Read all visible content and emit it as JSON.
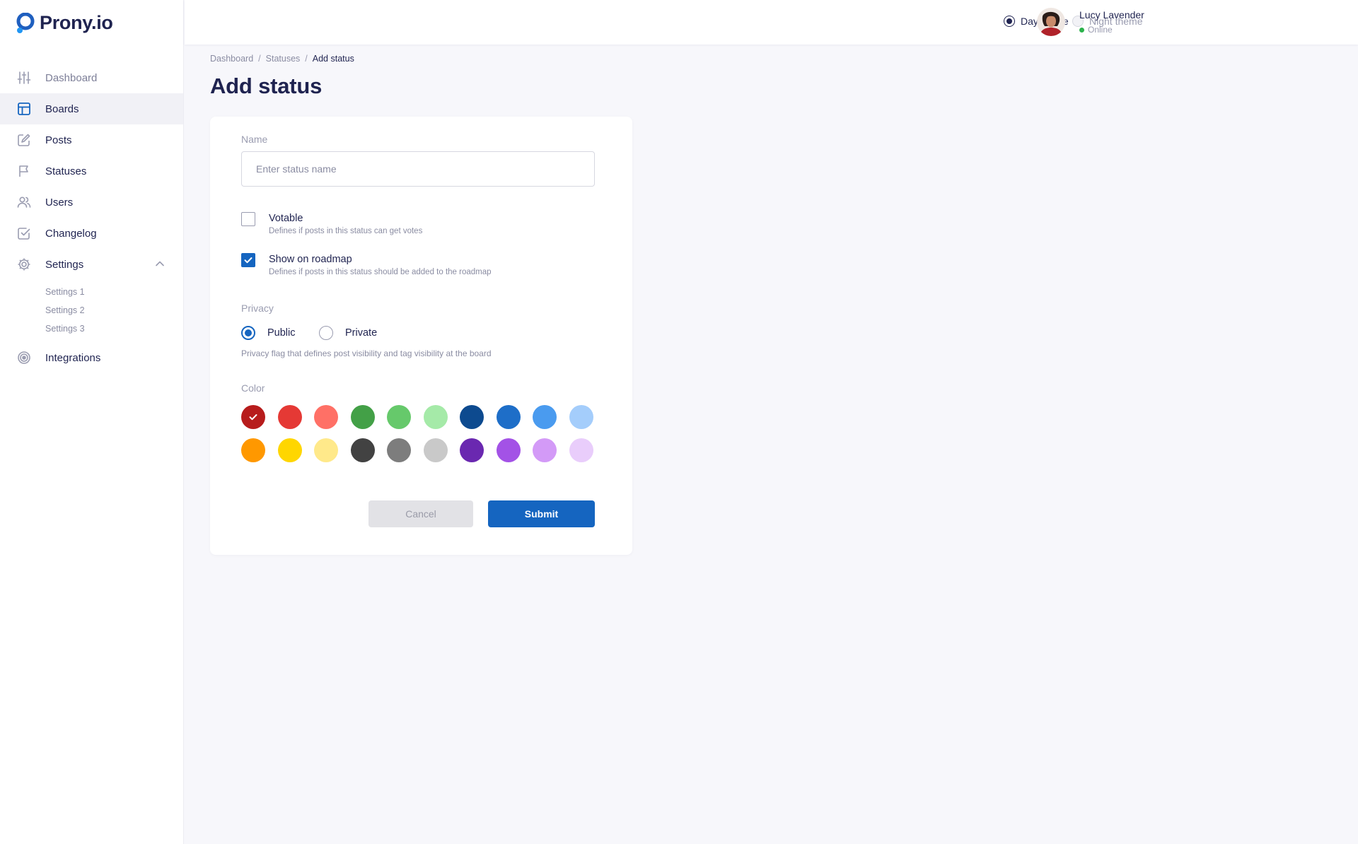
{
  "app": {
    "logo_text": "Prony.io",
    "brand_color": "#1565c0"
  },
  "sidebar": {
    "items": [
      {
        "label": "Dashboard",
        "icon": "sliders-icon"
      },
      {
        "label": "Boards",
        "icon": "layout-icon"
      },
      {
        "label": "Posts",
        "icon": "edit-icon"
      },
      {
        "label": "Statuses",
        "icon": "flag-icon"
      },
      {
        "label": "Users",
        "icon": "users-icon"
      },
      {
        "label": "Changelog",
        "icon": "check-square-icon"
      },
      {
        "label": "Settings",
        "icon": "gear-icon"
      },
      {
        "label": "Integrations",
        "icon": "target-icon"
      }
    ],
    "settings_sub": [
      "Settings 1",
      "Settings 2",
      "Settings 3"
    ],
    "active": "Boards"
  },
  "header": {
    "themes": [
      {
        "label": "Day theme",
        "selected": true
      },
      {
        "label": "Night theme",
        "selected": false
      }
    ],
    "user": {
      "name": "Lucy Lavender",
      "status": "Online"
    }
  },
  "breadcrumb": [
    "Dashboard",
    "Statuses",
    "Add status"
  ],
  "page_title": "Add status",
  "form": {
    "name_label": "Name",
    "name_placeholder": "Enter status name",
    "name_value": "",
    "votable": {
      "title": "Votable",
      "desc": "Defines if posts in this status can get votes",
      "checked": false
    },
    "roadmap": {
      "title": "Show on roadmap",
      "desc": "Defines if posts in this status should be added to the roadmap",
      "checked": true
    },
    "privacy_label": "Privacy",
    "privacy_options": [
      {
        "label": "Public",
        "selected": true
      },
      {
        "label": "Private",
        "selected": false
      }
    ],
    "privacy_hint": "Privacy flag that defines post visibility and tag visibility at the board",
    "color_label": "Color",
    "colors": [
      "#b71c1c",
      "#e53935",
      "#ff7066",
      "#43a047",
      "#66c96b",
      "#a5eaa8",
      "#0d4a8f",
      "#1e6ec8",
      "#4a9bef",
      "#a4cdfb",
      "#ff9800",
      "#ffd600",
      "#ffe98a",
      "#424242",
      "#7d7d7d",
      "#c9c9c9",
      "#6a28b0",
      "#a352e6",
      "#d39af7",
      "#e9cdfb"
    ],
    "selected_color_index": 0,
    "cancel_label": "Cancel",
    "submit_label": "Submit"
  }
}
